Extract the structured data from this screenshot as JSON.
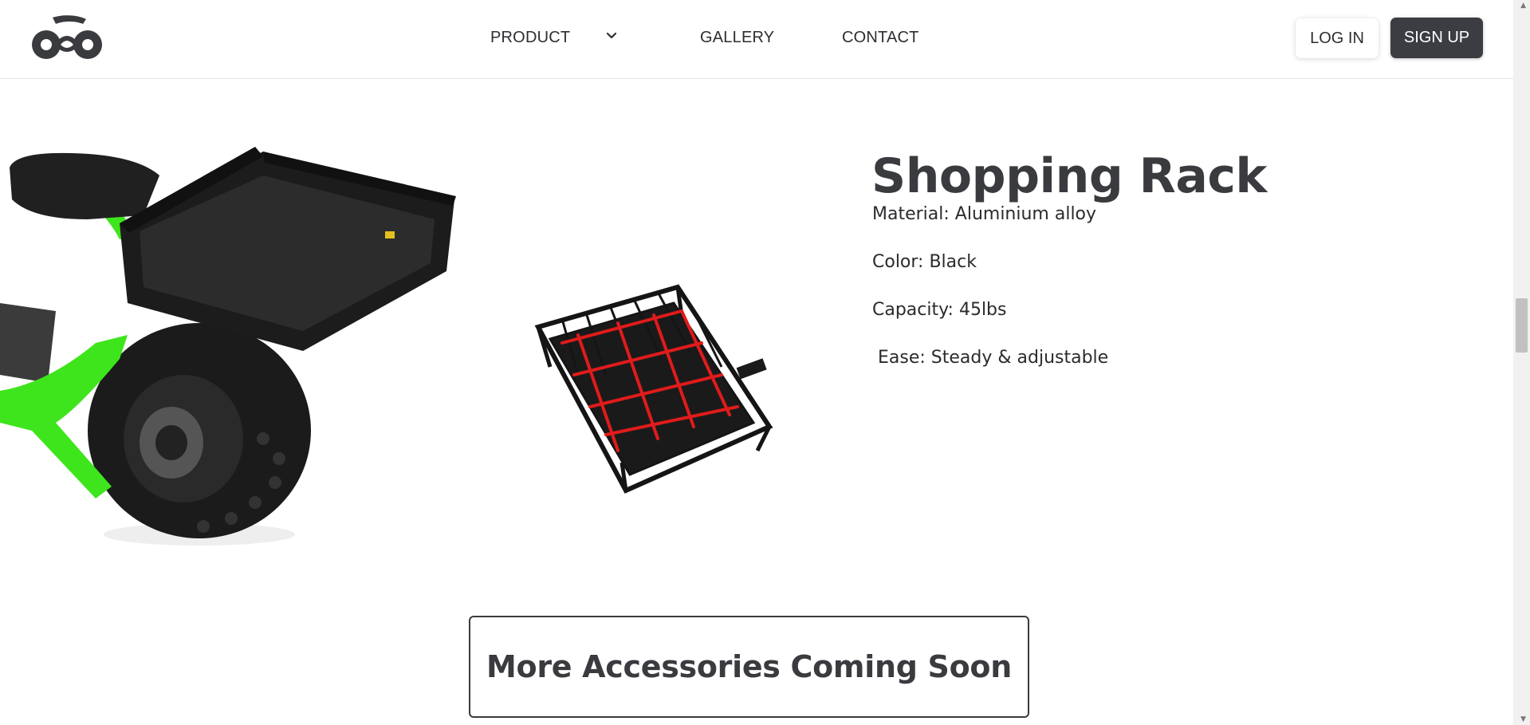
{
  "header": {
    "logo": "bike-logo-icon",
    "nav": [
      {
        "label": "PRODUCT",
        "has_dropdown": true
      },
      {
        "label": "GALLERY"
      },
      {
        "label": "CONTACT"
      }
    ],
    "login_label": "LOG IN",
    "signup_label": "SIGN UP"
  },
  "product": {
    "title": "Shopping Rack",
    "specs": [
      "Material: Aluminium alloy",
      "Color: Black",
      "Capacity: 45lbs",
      " Ease: Steady & adjustable"
    ],
    "images": [
      "scooter-with-rack",
      "basket-with-red-net"
    ]
  },
  "banner": {
    "text": "More Accessories Coming Soon"
  },
  "colors": {
    "dark": "#3a3b3f",
    "signup_bg": "#3b3d42",
    "scooter_green": "#3ee51c",
    "net_red": "#e01b1b"
  }
}
